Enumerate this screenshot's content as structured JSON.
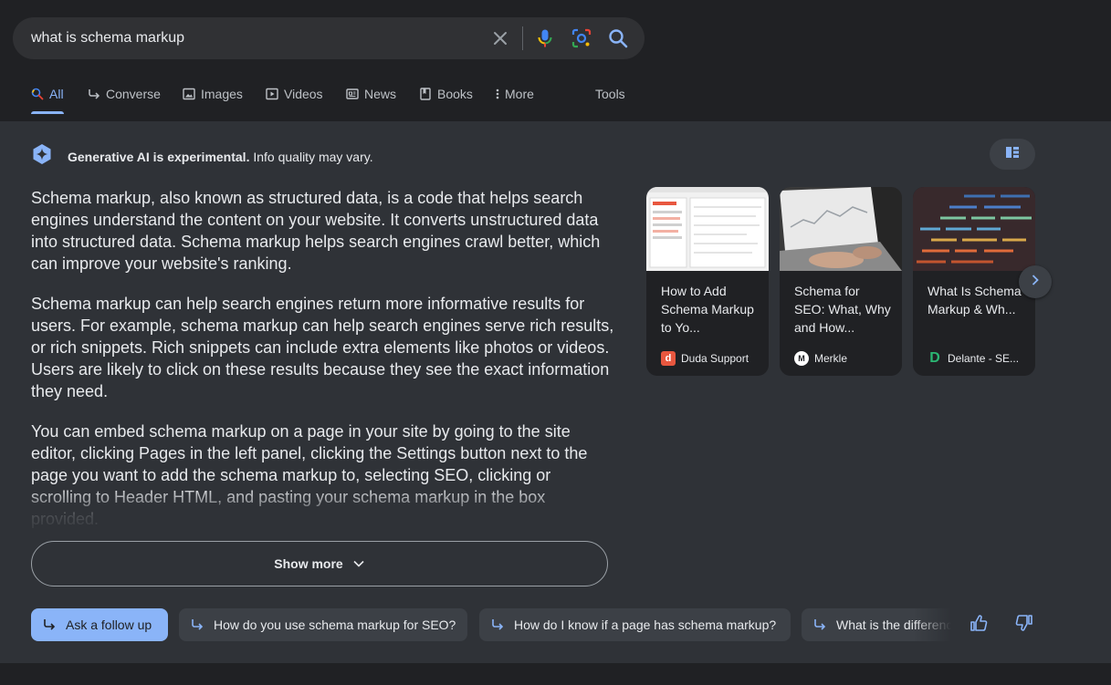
{
  "search": {
    "query": "what is schema markup"
  },
  "tabs": [
    {
      "label": "All",
      "icon": "search-icon"
    },
    {
      "label": "Converse",
      "icon": "follow-up-arrow-icon"
    },
    {
      "label": "Images",
      "icon": "image-icon"
    },
    {
      "label": "Videos",
      "icon": "video-icon"
    },
    {
      "label": "News",
      "icon": "news-icon"
    },
    {
      "label": "Books",
      "icon": "book-icon"
    },
    {
      "label": "More",
      "icon": "more-vert-icon"
    },
    {
      "label": "Tools"
    }
  ],
  "ai": {
    "header_bold": "Generative AI is experimental.",
    "header_rest": " Info quality may vary.",
    "paragraphs": [
      "Schema markup, also known as structured data, is a code that helps search engines understand the content on your website. It converts unstructured data into structured data. Schema markup helps search engines crawl better, which can improve your website's ranking.",
      "Schema markup can help search engines return more informative results for users. For example, schema markup can help search engines serve rich results, or rich snippets. Rich snippets can include extra elements like photos or videos. Users are likely to click on these results because they see the exact information they need.",
      "You can embed schema markup on a page in your site by going to the site editor, clicking Pages in the left panel, clicking the Settings button next to the page you want to add the schema markup to, selecting SEO, clicking or scrolling to Header HTML, and pasting your schema markup in the box provided."
    ],
    "show_more": "Show more"
  },
  "cards": [
    {
      "title": "How to Add Schema Markup to Yo...",
      "source": "Duda Support",
      "favicon_letter": "d",
      "favicon_color": "#e8573f"
    },
    {
      "title": "Schema for SEO: What, Why and How...",
      "source": "Merkle",
      "favicon_letter": "M",
      "favicon_color": "#ffffff"
    },
    {
      "title": "What Is Schema Markup & Wh...",
      "source": "Delante - SE...",
      "favicon_letter": "D",
      "favicon_color": "#2bb673"
    }
  ],
  "followups": {
    "primary": "Ask a follow up",
    "items": [
      "How do you use schema markup for SEO?",
      "How do I know if a page has schema markup?",
      "What is the difference"
    ]
  },
  "colors": {
    "accent": "#8ab4f8",
    "page_bg": "#202124",
    "panel_bg": "#2f3237"
  }
}
